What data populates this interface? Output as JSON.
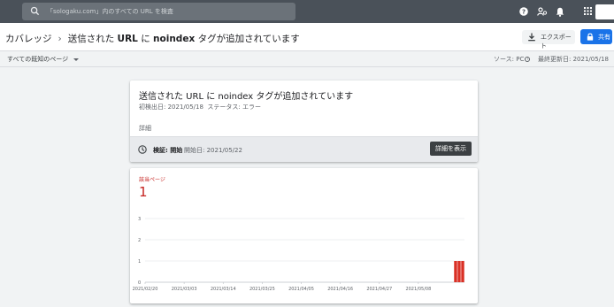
{
  "topbar": {
    "search_placeholder": "「sologaku.com」内のすべての URL を検査",
    "icons": [
      "search-icon",
      "help-icon",
      "users-icon",
      "bell-icon",
      "apps-grid-icon"
    ]
  },
  "header": {
    "breadcrumb_root": "カバレッジ",
    "breadcrumb_separator": "›",
    "breadcrumb_current_pre": "送信された ",
    "breadcrumb_current_url": "URL",
    "breadcrumb_current_mid": " に ",
    "breadcrumb_current_tag": "noindex",
    "breadcrumb_current_post": " タグが追加されています",
    "export_label": "エクスポート",
    "share_label": "共有"
  },
  "filter": {
    "selected": "すべての既知のページ",
    "source": "ソース: PC",
    "last_updated": "最終更新日: 2021/05/18"
  },
  "issue_card": {
    "title": "送信された URL に noindex タグが追加されています",
    "first_detected": "初検出日: 2021/05/18",
    "status": "ステータス: エラー",
    "details_label": "詳細",
    "validation_label": "検証: 開始",
    "validation_started": "開始日: 2021/05/22",
    "see_details_button": "詳細を表示"
  },
  "affected_card": {
    "label": "該当ページ",
    "value": "1"
  },
  "colors": {
    "topbar": "#4a5159",
    "accent_blue": "#1a73e8",
    "error_red": "#c5221f",
    "bar_red": "#d93025"
  },
  "chart_data": {
    "type": "bar",
    "title": "",
    "xlabel": "",
    "ylabel": "",
    "ylim": [
      0,
      3
    ],
    "yticks": [
      0,
      1,
      2,
      3
    ],
    "x_tick_labels": [
      "2021/02/20",
      "2021/03/03",
      "2021/03/14",
      "2021/03/25",
      "2021/04/05",
      "2021/04/16",
      "2021/04/27",
      "2021/05/08"
    ],
    "x_start": "2021/02/20",
    "x_end": "2021/05/21",
    "categories": [
      "2021/05/18",
      "2021/05/19",
      "2021/05/20"
    ],
    "values": [
      1,
      1,
      1
    ],
    "grid": true
  }
}
